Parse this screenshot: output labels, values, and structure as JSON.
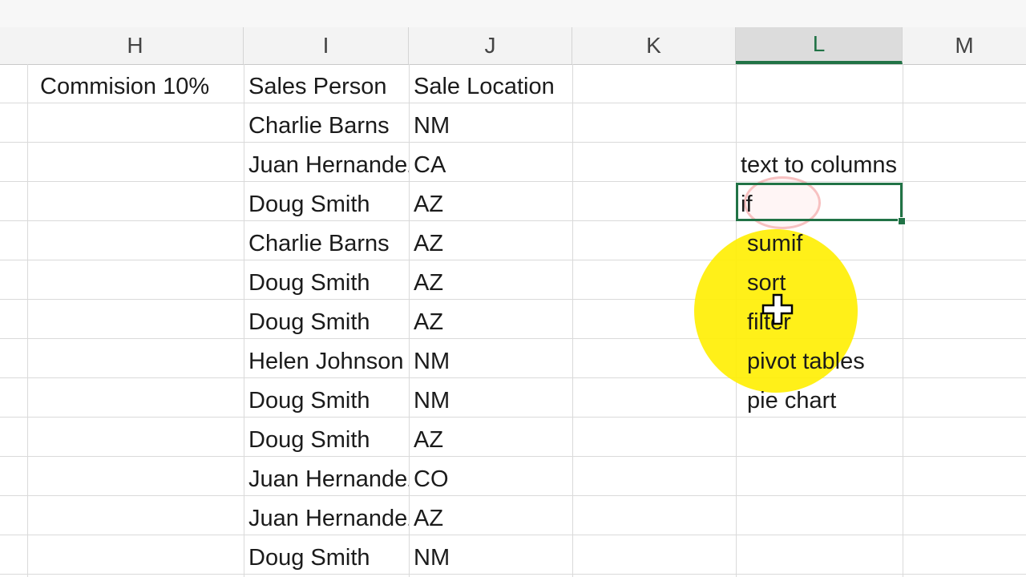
{
  "columns": [
    {
      "letter": "H"
    },
    {
      "letter": "I"
    },
    {
      "letter": "J"
    },
    {
      "letter": "K"
    },
    {
      "letter": "L"
    },
    {
      "letter": "M"
    }
  ],
  "header_row": {
    "h": "Commision 10%",
    "i": "Sales Person",
    "j": "Sale Location"
  },
  "rows": [
    {
      "person": "Charlie Barns",
      "location": "NM"
    },
    {
      "person": "Juan Hernandez",
      "location": "CA"
    },
    {
      "person": "Doug Smith",
      "location": "AZ"
    },
    {
      "person": "Charlie Barns",
      "location": "AZ"
    },
    {
      "person": "Doug Smith",
      "location": "AZ"
    },
    {
      "person": "Doug Smith",
      "location": "AZ"
    },
    {
      "person": "Helen Johnson",
      "location": "NM"
    },
    {
      "person": "Doug Smith",
      "location": "NM"
    },
    {
      "person": "Doug Smith",
      "location": "AZ"
    },
    {
      "person": "Juan Hernandez",
      "location": "CO"
    },
    {
      "person": "Juan Hernandez",
      "location": "AZ"
    },
    {
      "person": "Doug Smith",
      "location": "NM"
    }
  ],
  "topics": [
    "text to columns",
    "if",
    " sumif",
    " sort",
    " filter",
    " pivot tables",
    " pie chart"
  ],
  "selected_column": "L",
  "colors": {
    "accent": "#217346",
    "highlight": "#ffee00"
  }
}
